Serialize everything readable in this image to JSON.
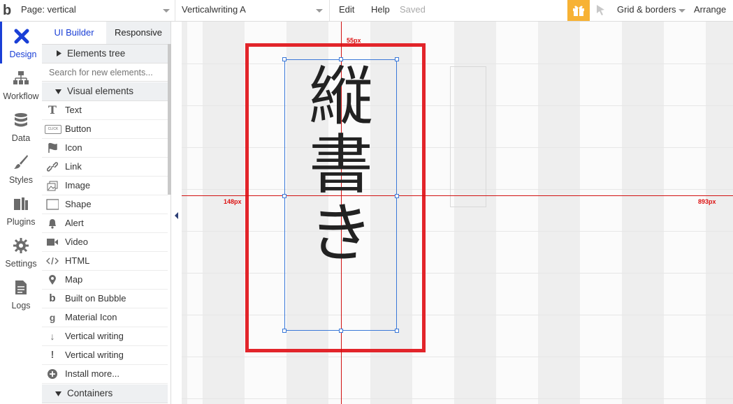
{
  "topbar": {
    "page_label": "Page: vertical",
    "element_label": "Verticalwriting A",
    "edit": "Edit",
    "help": "Help",
    "saved": "Saved",
    "grid": "Grid & borders",
    "arrange": "Arrange"
  },
  "rail": {
    "items": [
      {
        "label": "Design",
        "icon": "design-icon"
      },
      {
        "label": "Workflow",
        "icon": "workflow-icon"
      },
      {
        "label": "Data",
        "icon": "data-icon"
      },
      {
        "label": "Styles",
        "icon": "styles-icon"
      },
      {
        "label": "Plugins",
        "icon": "plugins-icon"
      },
      {
        "label": "Settings",
        "icon": "settings-icon"
      },
      {
        "label": "Logs",
        "icon": "logs-icon"
      }
    ]
  },
  "panel": {
    "tabs": [
      "UI Builder",
      "Responsive"
    ],
    "elements_tree": "Elements tree",
    "search_placeholder": "Search for new elements...",
    "visual_elements": "Visual elements",
    "items": [
      {
        "label": "Text",
        "icon": "text-icon"
      },
      {
        "label": "Button",
        "icon": "button-icon"
      },
      {
        "label": "Icon",
        "icon": "flag-icon"
      },
      {
        "label": "Link",
        "icon": "link-icon"
      },
      {
        "label": "Image",
        "icon": "image-icon"
      },
      {
        "label": "Shape",
        "icon": "shape-icon"
      },
      {
        "label": "Alert",
        "icon": "bell-icon"
      },
      {
        "label": "Video",
        "icon": "video-icon"
      },
      {
        "label": "HTML",
        "icon": "code-icon"
      },
      {
        "label": "Map",
        "icon": "pin-icon"
      },
      {
        "label": "Built on Bubble",
        "icon": "bubble-icon"
      },
      {
        "label": "Material Icon",
        "icon": "material-icon"
      },
      {
        "label": "Vertical writing",
        "icon": "arrow-down-icon"
      },
      {
        "label": "Vertical writing",
        "icon": "exclamation-icon"
      },
      {
        "label": "Install more...",
        "icon": "plus-circle-icon"
      }
    ],
    "containers": "Containers",
    "button_icon_text": "CLICK"
  },
  "canvas": {
    "top_offset": "55px",
    "left_offset": "148px",
    "right_offset": "893px",
    "vertical_text": [
      "縦",
      "書",
      "き"
    ]
  },
  "colors": {
    "accent": "#1a3fd6",
    "gift": "#f7b234",
    "guide": "#d11111",
    "highlight_box": "#e2242a",
    "selection": "#3a78d8"
  }
}
